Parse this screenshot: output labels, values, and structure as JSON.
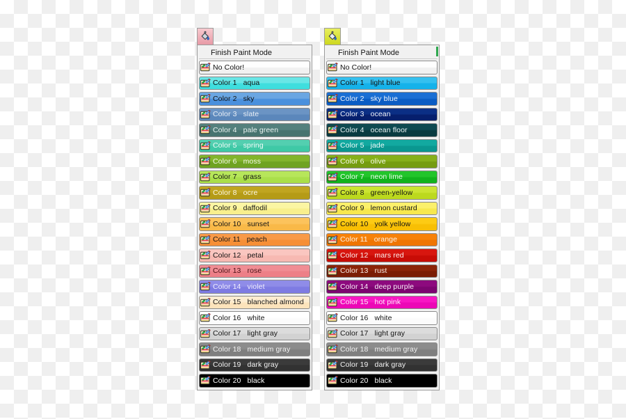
{
  "background": {
    "type": "transparency-checkerboard",
    "light": "#ffffff",
    "dark": "#efefef"
  },
  "panels": [
    {
      "id": "left",
      "tab": {
        "icon": "paint-bucket-icon",
        "bg_top": "#f7c9cf",
        "bg_bottom": "#e79aa6",
        "title": ""
      },
      "header": {
        "label": "Finish Paint Mode"
      },
      "rows": [
        {
          "index": "",
          "name": "No Color!",
          "bg_top": "#fefefe",
          "bg_bottom": "#f1f1f1",
          "text": "#111111"
        },
        {
          "index": "Color  1",
          "name": "aqua",
          "bg_top": "#69e6e6",
          "bg_bottom": "#3fdede",
          "text": "#111111"
        },
        {
          "index": "Color  2",
          "name": "sky",
          "bg_top": "#6aa6e2",
          "bg_bottom": "#4a90dd",
          "text": "#111111"
        },
        {
          "index": "Color  3",
          "name": "slate",
          "bg_top": "#6b94c4",
          "bg_bottom": "#5b87bb",
          "text": "#e8eef6"
        },
        {
          "index": "Color  4",
          "name": "pale green",
          "bg_top": "#54807d",
          "bg_bottom": "#47736f",
          "text": "#eaf3f1"
        },
        {
          "index": "Color  5",
          "name": "spring",
          "bg_top": "#53cfb0",
          "bg_bottom": "#3fc9a6",
          "text": "#f2fbf8"
        },
        {
          "index": "Color  6",
          "name": "moss",
          "bg_top": "#82b52c",
          "bg_bottom": "#6fa321",
          "text": "#f4f9ea"
        },
        {
          "index": "Color  7",
          "name": "grass",
          "bg_top": "#b7e65a",
          "bg_bottom": "#aadf4a",
          "text": "#141414"
        },
        {
          "index": "Color  8",
          "name": "ocre",
          "bg_top": "#c0a520",
          "bg_bottom": "#b59b16",
          "text": "#fbf7e4"
        },
        {
          "index": "Color  9",
          "name": "daffodil",
          "bg_top": "#fbf5a3",
          "bg_bottom": "#f8ef8d",
          "text": "#141414"
        },
        {
          "index": "Color  10",
          "name": "sunset",
          "bg_top": "#fcc35c",
          "bg_bottom": "#f9b948",
          "text": "#141414"
        },
        {
          "index": "Color  11",
          "name": "peach",
          "bg_top": "#f89a48",
          "bg_bottom": "#f68f36",
          "text": "#141414"
        },
        {
          "index": "Color  12",
          "name": "petal",
          "bg_top": "#fac6c0",
          "bg_bottom": "#f7b9b2",
          "text": "#141414"
        },
        {
          "index": "Color  13",
          "name": "rose",
          "bg_top": "#f08d94",
          "bg_bottom": "#ed7f87",
          "text": "#4a1216"
        },
        {
          "index": "Color  14",
          "name": "violet",
          "bg_top": "#8f8ce8",
          "bg_bottom": "#7e7be3",
          "text": "#f0eefd"
        },
        {
          "index": "Color  15",
          "name": "blanched almond",
          "bg_top": "#fdecd0",
          "bg_bottom": "#fce3bb",
          "text": "#141414"
        },
        {
          "index": "Color  16",
          "name": "white",
          "bg_top": "#ffffff",
          "bg_bottom": "#fbfbfb",
          "text": "#141414"
        },
        {
          "index": "Color  17",
          "name": "light gray",
          "bg_top": "#dcdcdc",
          "bg_bottom": "#d2d2d2",
          "text": "#141414"
        },
        {
          "index": "Color  18",
          "name": "medium gray",
          "bg_top": "#8c8c8c",
          "bg_bottom": "#7f7f7f",
          "text": "#f2f2f2"
        },
        {
          "index": "Color  19",
          "name": "dark gray",
          "bg_top": "#3b3b3b",
          "bg_bottom": "#323232",
          "text": "#f2f2f2"
        },
        {
          "index": "Color  20",
          "name": "black",
          "bg_top": "#000000",
          "bg_bottom": "#000000",
          "text": "#ffffff"
        }
      ]
    },
    {
      "id": "right",
      "tab": {
        "icon": "paint-bucket-icon",
        "bg_top": "#e8ef5e",
        "bg_bottom": "#cdd81f",
        "title": ""
      },
      "header": {
        "label": "Finish Paint Mode"
      },
      "scrollbar": {
        "visible": true,
        "thumb_color": "#2fa84f"
      },
      "rows": [
        {
          "index": "",
          "name": "No Color!",
          "bg_top": "#fefefe",
          "bg_bottom": "#f1f1f1",
          "text": "#111111"
        },
        {
          "index": "Color  1",
          "name": "light blue",
          "bg_top": "#35c0ef",
          "bg_bottom": "#15b2ea",
          "text": "#111111"
        },
        {
          "index": "Color  2",
          "name": "sky blue",
          "bg_top": "#1a6fd4",
          "bg_bottom": "#0a5cc4",
          "text": "#f2f6fc"
        },
        {
          "index": "Color  3",
          "name": "ocean",
          "bg_top": "#0b2f85",
          "bg_bottom": "#061f6d",
          "text": "#f0f3fb"
        },
        {
          "index": "Color  4",
          "name": "ocean floor",
          "bg_top": "#0f4a51",
          "bg_bottom": "#093a40",
          "text": "#eaf4f5"
        },
        {
          "index": "Color  5",
          "name": "jade",
          "bg_top": "#12a9a0",
          "bg_bottom": "#0a9790",
          "text": "#f0fbfa"
        },
        {
          "index": "Color  6",
          "name": "olive",
          "bg_top": "#86b01a",
          "bg_bottom": "#759c10",
          "text": "#f7faea"
        },
        {
          "index": "Color  7",
          "name": "neon lime",
          "bg_top": "#22c52b",
          "bg_bottom": "#11b31d",
          "text": "#f1fcf1"
        },
        {
          "index": "Color  8",
          "name": "green-yellow",
          "bg_top": "#cbe432",
          "bg_bottom": "#bcd91e",
          "text": "#141414"
        },
        {
          "index": "Color  9",
          "name": "lemon custard",
          "bg_top": "#fbf06b",
          "bg_bottom": "#f7e84e",
          "text": "#141414"
        },
        {
          "index": "Color  10",
          "name": "yolk yellow",
          "bg_top": "#fdcb14",
          "bg_bottom": "#f8bf04",
          "text": "#141414"
        },
        {
          "index": "Color  11",
          "name": "orange",
          "bg_top": "#f78209",
          "bg_bottom": "#ef7503",
          "text": "#fdf4ea"
        },
        {
          "index": "Color  12",
          "name": "mars red",
          "bg_top": "#d8160f",
          "bg_bottom": "#c80c06",
          "text": "#fdf1f0"
        },
        {
          "index": "Color  13",
          "name": "rust",
          "bg_top": "#8b2408",
          "bg_bottom": "#7a1d05",
          "text": "#fbeee9"
        },
        {
          "index": "Color  14",
          "name": "deep purple",
          "bg_top": "#8d0a7e",
          "bg_bottom": "#7c0570",
          "text": "#fbeff9"
        },
        {
          "index": "Color  15",
          "name": "hot pink",
          "bg_top": "#f816c4",
          "bg_bottom": "#ec08b6",
          "text": "#fdeffa"
        },
        {
          "index": "Color  16",
          "name": "white",
          "bg_top": "#ffffff",
          "bg_bottom": "#fbfbfb",
          "text": "#141414"
        },
        {
          "index": "Color  17",
          "name": "light gray",
          "bg_top": "#dcdcdc",
          "bg_bottom": "#d2d2d2",
          "text": "#141414"
        },
        {
          "index": "Color  18",
          "name": "medium gray",
          "bg_top": "#8c8c8c",
          "bg_bottom": "#7f7f7f",
          "text": "#f2f2f2"
        },
        {
          "index": "Color  19",
          "name": "dark gray",
          "bg_top": "#3b3b3b",
          "bg_bottom": "#323232",
          "text": "#f2f2f2"
        },
        {
          "index": "Color  20",
          "name": "black",
          "bg_top": "#000000",
          "bg_bottom": "#000000",
          "text": "#ffffff"
        }
      ]
    }
  ]
}
